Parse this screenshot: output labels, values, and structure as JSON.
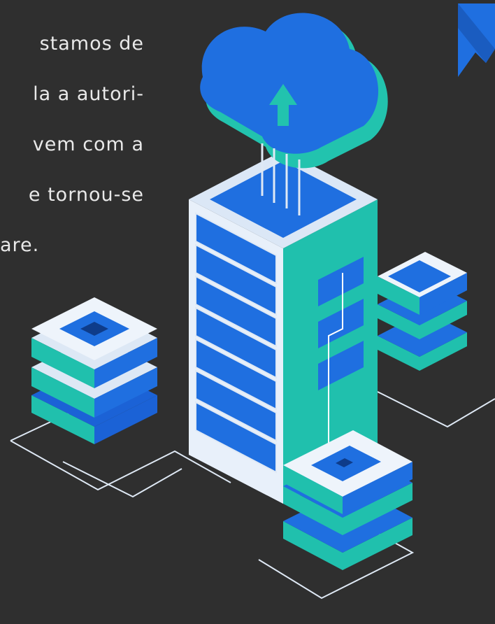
{
  "paragraph": {
    "lines": [
      "stamos   de",
      "la a autori-",
      "vem com a",
      "e tornou-se",
      "are."
    ]
  },
  "illustration": {
    "subject": "cloud-server-rack-icon",
    "colors": {
      "background": "#2f2f2f",
      "blue": "#1f6fe0",
      "teal": "#22c3ae",
      "light": "#dde8f5",
      "white": "#ffffff"
    }
  },
  "brand": {
    "logo": "corner-logo-icon"
  }
}
